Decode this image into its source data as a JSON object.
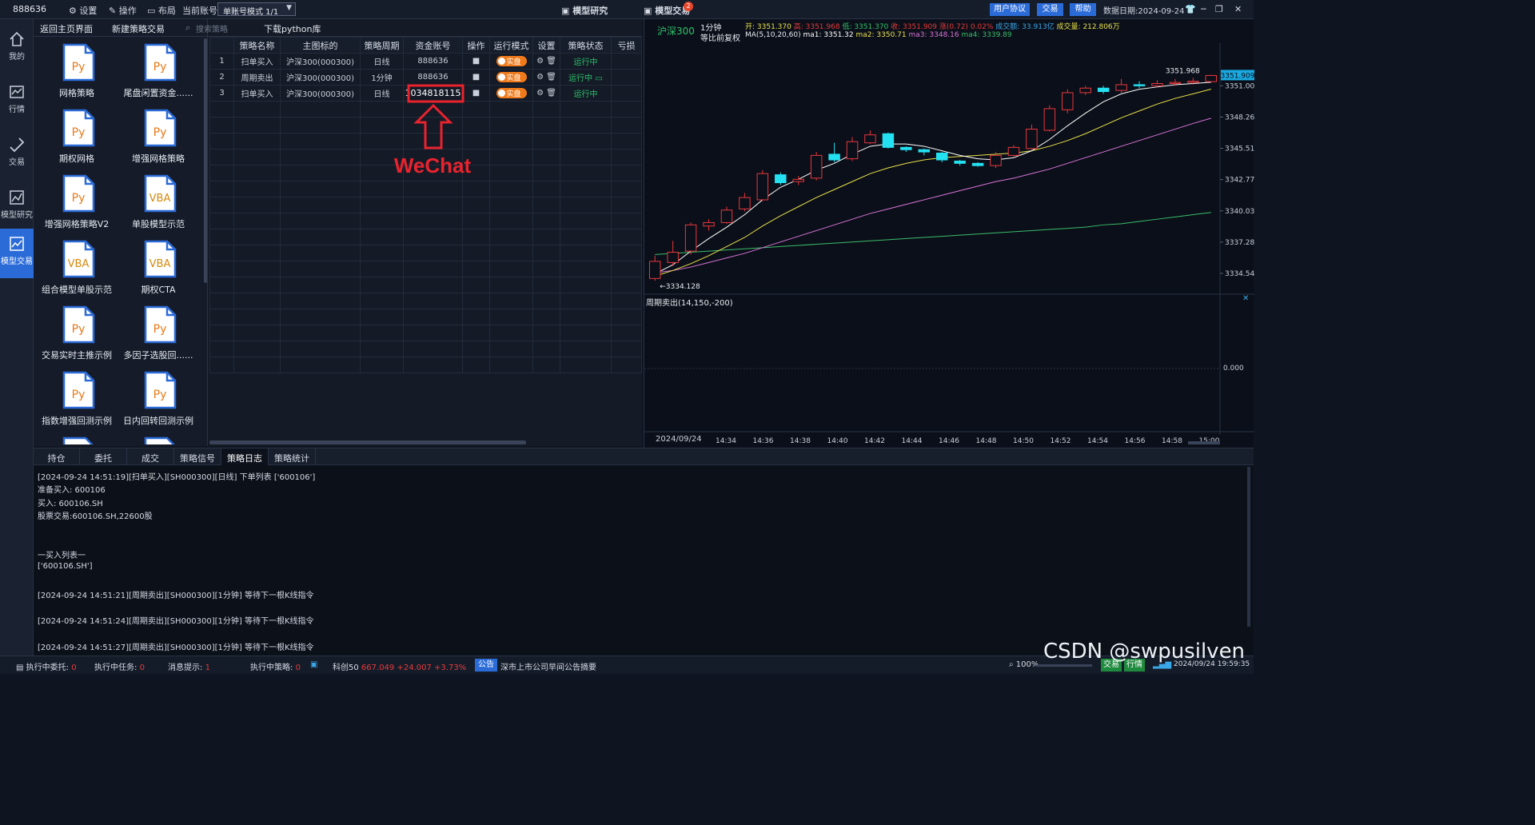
{
  "topbar": {
    "account_id": "888636",
    "settings_label": "设置",
    "operation_label": "操作",
    "layout_label": "布局",
    "current_account_label": "当前账号",
    "account_mode": "单账号模式 1/1",
    "model_research": "模型研究",
    "model_trading": "模型交易",
    "model_trading_badge": "2",
    "user_agreement": "用户协议",
    "trade": "交易",
    "help": "帮助",
    "data_date": "数据日期:2024-09-24"
  },
  "leftnav": {
    "items": [
      {
        "label": "我的",
        "icon": "home-icon"
      },
      {
        "label": "行情",
        "icon": "chart-icon"
      },
      {
        "label": "交易",
        "icon": "trade-arrows-icon"
      },
      {
        "label": "模型研究",
        "icon": "research-icon"
      },
      {
        "label": "模型交易",
        "icon": "model-trade-icon"
      }
    ]
  },
  "strategy_panel": {
    "back_home": "返回主页界面",
    "new_strategy": "新建策略交易",
    "tiles": [
      {
        "kind": "Py",
        "name": "网格策略"
      },
      {
        "kind": "Py",
        "name": "尾盘闲置资金......"
      },
      {
        "kind": "Py",
        "name": "期权网格"
      },
      {
        "kind": "Py",
        "name": "增强网格策略"
      },
      {
        "kind": "Py",
        "name": "增强网格策略V2"
      },
      {
        "kind": "VBA",
        "name": "单股模型示范"
      },
      {
        "kind": "VBA",
        "name": "组合模型单股示范"
      },
      {
        "kind": "VBA",
        "name": "期权CTA"
      },
      {
        "kind": "Py",
        "name": "交易实时主推示例"
      },
      {
        "kind": "Py",
        "name": "多因子选股回......"
      },
      {
        "kind": "Py",
        "name": "指数增强回测示例"
      },
      {
        "kind": "Py",
        "name": "日内回转回测示例"
      }
    ]
  },
  "grid": {
    "search_placeholder": "搜索策略",
    "download_python": "下载python库",
    "columns": [
      "",
      "策略名称",
      "主图标的",
      "策略周期",
      "资金账号",
      "操作",
      "运行模式",
      "设置",
      "策略状态",
      "亏损"
    ],
    "rows": [
      {
        "idx": "1",
        "name": "扫单买入",
        "target": "沪深300(000300)",
        "period": "日线",
        "account": "888636",
        "mode": "实盘",
        "status": "运行中"
      },
      {
        "idx": "2",
        "name": "周期卖出",
        "target": "沪深300(000300)",
        "period": "1分钟",
        "account": "888636",
        "mode": "实盘",
        "status": "运行中"
      },
      {
        "idx": "3",
        "name": "扫单买入",
        "target": "沪深300(000300)",
        "period": "日线",
        "account": "1034818115",
        "mode": "实盘",
        "status": "运行中"
      }
    ],
    "annotation": "WeChat"
  },
  "chart": {
    "symbol": "沪深300",
    "period": "1分钟",
    "adjust": "等比前复权",
    "open": "开: 3351.370",
    "high": "高: 3351.968",
    "low": "低: 3351.370",
    "close": "收: 3351.909",
    "change": "涨(0.72)",
    "pct": "0.02%",
    "amount": "成交额: 33.913亿",
    "volume": "成交量: 212.806万",
    "ma_label": "MA(5,10,20,60)",
    "ma1": "ma1: 3351.32",
    "ma2": "ma2: 3350.71",
    "ma3": "ma3: 3348.16",
    "ma4": "ma4: 3339.89",
    "sub_title": "周期卖出(14,150,-200)",
    "sub_zero": "0.000",
    "close_marker": "3351.909",
    "high_marker": "3351.968",
    "low_marker": "3334.128",
    "date_label": "2024/09/24",
    "colors": {
      "up": "#e8383d",
      "down": "#24e1f2",
      "ma1": "#ffffff",
      "ma2": "#e8e04a",
      "ma3": "#d874d8",
      "ma4": "#3bbd6a"
    }
  },
  "chart_data": {
    "type": "candlestick",
    "title": "沪深300",
    "x": [
      "14:34",
      "14:36",
      "14:38",
      "14:40",
      "14:42",
      "14:44",
      "14:46",
      "14:48",
      "14:50",
      "14:52",
      "14:54",
      "14:56",
      "14:58",
      "15:00"
    ],
    "y_ticks": [
      3351.008,
      3348.263,
      3345.519,
      3342.775,
      3340.031,
      3337.287,
      3334.542
    ],
    "ylim": [
      3333.0,
      3352.5
    ],
    "candles": [
      [
        3334.1,
        3335.6,
        3333.9,
        3336.1
      ],
      [
        3335.5,
        3336.4,
        3335.2,
        3337.4
      ],
      [
        3336.5,
        3338.8,
        3336.2,
        3339.0
      ],
      [
        3338.7,
        3339.0,
        3338.3,
        3339.3
      ],
      [
        3339.0,
        3340.1,
        3338.9,
        3340.4
      ],
      [
        3340.2,
        3341.2,
        3340.0,
        3341.6
      ],
      [
        3341.0,
        3343.3,
        3340.9,
        3343.6
      ],
      [
        3343.2,
        3342.5,
        3342.3,
        3343.4
      ],
      [
        3342.6,
        3342.8,
        3342.3,
        3343.1
      ],
      [
        3342.9,
        3344.9,
        3342.7,
        3345.2
      ],
      [
        3345.0,
        3344.5,
        3344.3,
        3346.0
      ],
      [
        3344.6,
        3346.1,
        3344.4,
        3346.5
      ],
      [
        3346.0,
        3346.7,
        3345.9,
        3347.1
      ],
      [
        3346.8,
        3345.6,
        3345.5,
        3346.9
      ],
      [
        3345.6,
        3345.4,
        3345.2,
        3345.7
      ],
      [
        3345.4,
        3345.2,
        3344.9,
        3345.5
      ],
      [
        3345.1,
        3344.5,
        3344.3,
        3345.2
      ],
      [
        3344.4,
        3344.2,
        3344.0,
        3344.5
      ],
      [
        3344.2,
        3344.0,
        3343.9,
        3344.3
      ],
      [
        3344.0,
        3344.9,
        3343.8,
        3345.2
      ],
      [
        3344.9,
        3345.6,
        3344.8,
        3345.8
      ],
      [
        3345.5,
        3347.2,
        3345.4,
        3347.6
      ],
      [
        3347.1,
        3349.0,
        3347.0,
        3349.3
      ],
      [
        3348.9,
        3350.4,
        3348.6,
        3350.7
      ],
      [
        3350.4,
        3350.8,
        3350.2,
        3351.0
      ],
      [
        3350.8,
        3350.5,
        3350.3,
        3351.0
      ],
      [
        3350.6,
        3351.1,
        3350.4,
        3351.6
      ],
      [
        3351.1,
        3351.0,
        3350.8,
        3351.4
      ],
      [
        3351.0,
        3351.2,
        3350.9,
        3351.5
      ],
      [
        3351.2,
        3351.3,
        3351.0,
        3351.6
      ],
      [
        3351.3,
        3351.4,
        3351.1,
        3351.7
      ],
      [
        3351.37,
        3351.909,
        3351.37,
        3351.968
      ]
    ],
    "ma_series": [
      {
        "name": "ma1",
        "values": [
          3334.5,
          3335.3,
          3336.5,
          3337.6,
          3338.6,
          3339.7,
          3341.0,
          3342.1,
          3342.8,
          3343.6,
          3344.2,
          3345.0,
          3345.7,
          3345.9,
          3345.9,
          3345.7,
          3345.3,
          3344.9,
          3344.6,
          3344.5,
          3344.7,
          3345.3,
          3346.3,
          3347.5,
          3348.6,
          3349.6,
          3350.3,
          3350.7,
          3350.9,
          3351.1,
          3351.2,
          3351.32
        ]
      },
      {
        "name": "ma2",
        "values": [
          3334.3,
          3334.8,
          3335.4,
          3336.1,
          3336.9,
          3337.7,
          3338.7,
          3339.6,
          3340.4,
          3341.2,
          3341.9,
          3342.6,
          3343.3,
          3343.8,
          3344.2,
          3344.5,
          3344.7,
          3344.8,
          3344.9,
          3345.0,
          3345.1,
          3345.3,
          3345.7,
          3346.2,
          3346.8,
          3347.5,
          3348.2,
          3348.8,
          3349.4,
          3349.9,
          3350.3,
          3350.71
        ]
      },
      {
        "name": "ma3",
        "values": [
          3334.6,
          3334.8,
          3335.1,
          3335.5,
          3335.9,
          3336.3,
          3336.8,
          3337.3,
          3337.8,
          3338.3,
          3338.8,
          3339.3,
          3339.8,
          3340.2,
          3340.6,
          3341.0,
          3341.4,
          3341.8,
          3342.2,
          3342.6,
          3342.9,
          3343.3,
          3343.7,
          3344.2,
          3344.7,
          3345.2,
          3345.7,
          3346.2,
          3346.7,
          3347.2,
          3347.7,
          3348.16
        ]
      },
      {
        "name": "ma4",
        "values": [
          3336.2,
          3336.3,
          3336.4,
          3336.5,
          3336.6,
          3336.7,
          3336.8,
          3336.9,
          3337.0,
          3337.1,
          3337.2,
          3337.3,
          3337.4,
          3337.5,
          3337.6,
          3337.7,
          3337.8,
          3337.9,
          3338.0,
          3338.1,
          3338.2,
          3338.3,
          3338.4,
          3338.5,
          3338.6,
          3338.8,
          3338.9,
          3339.1,
          3339.3,
          3339.5,
          3339.7,
          3339.89
        ]
      }
    ]
  },
  "bottom_tabs": [
    "持仓",
    "委托",
    "成交",
    "策略信号",
    "策略日志",
    "策略统计"
  ],
  "log_lines": [
    "[2024-09-24 14:51:19][扫单买入][SH000300][日线] 下单列表 ['600106']",
    "准备买入:  600106",
    "买入: 600106.SH",
    "股票交易:600106.SH,22600股",
    "",
    "",
    "一买入列表一",
    "['600106.SH']",
    "",
    "[2024-09-24 14:51:21][周期卖出][SH000300][1分钟] 等待下一根K线指令",
    "",
    "[2024-09-24 14:51:24][周期卖出][SH000300][1分钟] 等待下一根K线指令",
    "",
    "[2024-09-24 14:51:27][周期卖出][SH000300][1分钟] 等待下一根K线指令"
  ],
  "statusbar": {
    "exec_orders_label": "执行中委托:",
    "exec_orders_val": "0",
    "exec_tasks_label": "执行中任务:",
    "exec_tasks_val": "0",
    "msg_label": "消息提示:",
    "msg_val": "1",
    "exec_strat_label": "执行中策略:",
    "exec_strat_val": "0",
    "index_name": "科创50",
    "index_val": "667.049",
    "index_chg": "+24.007",
    "index_pct": "+3.73%",
    "notice_tag": "公告",
    "notice_text": "深市上市公司早间公告摘要",
    "zoom": "100%",
    "trade_btn": "交易",
    "quote_btn": "行情",
    "datetime": "2024/09/24 19:59:35",
    "watermark": "CSDN @swpusilven"
  }
}
